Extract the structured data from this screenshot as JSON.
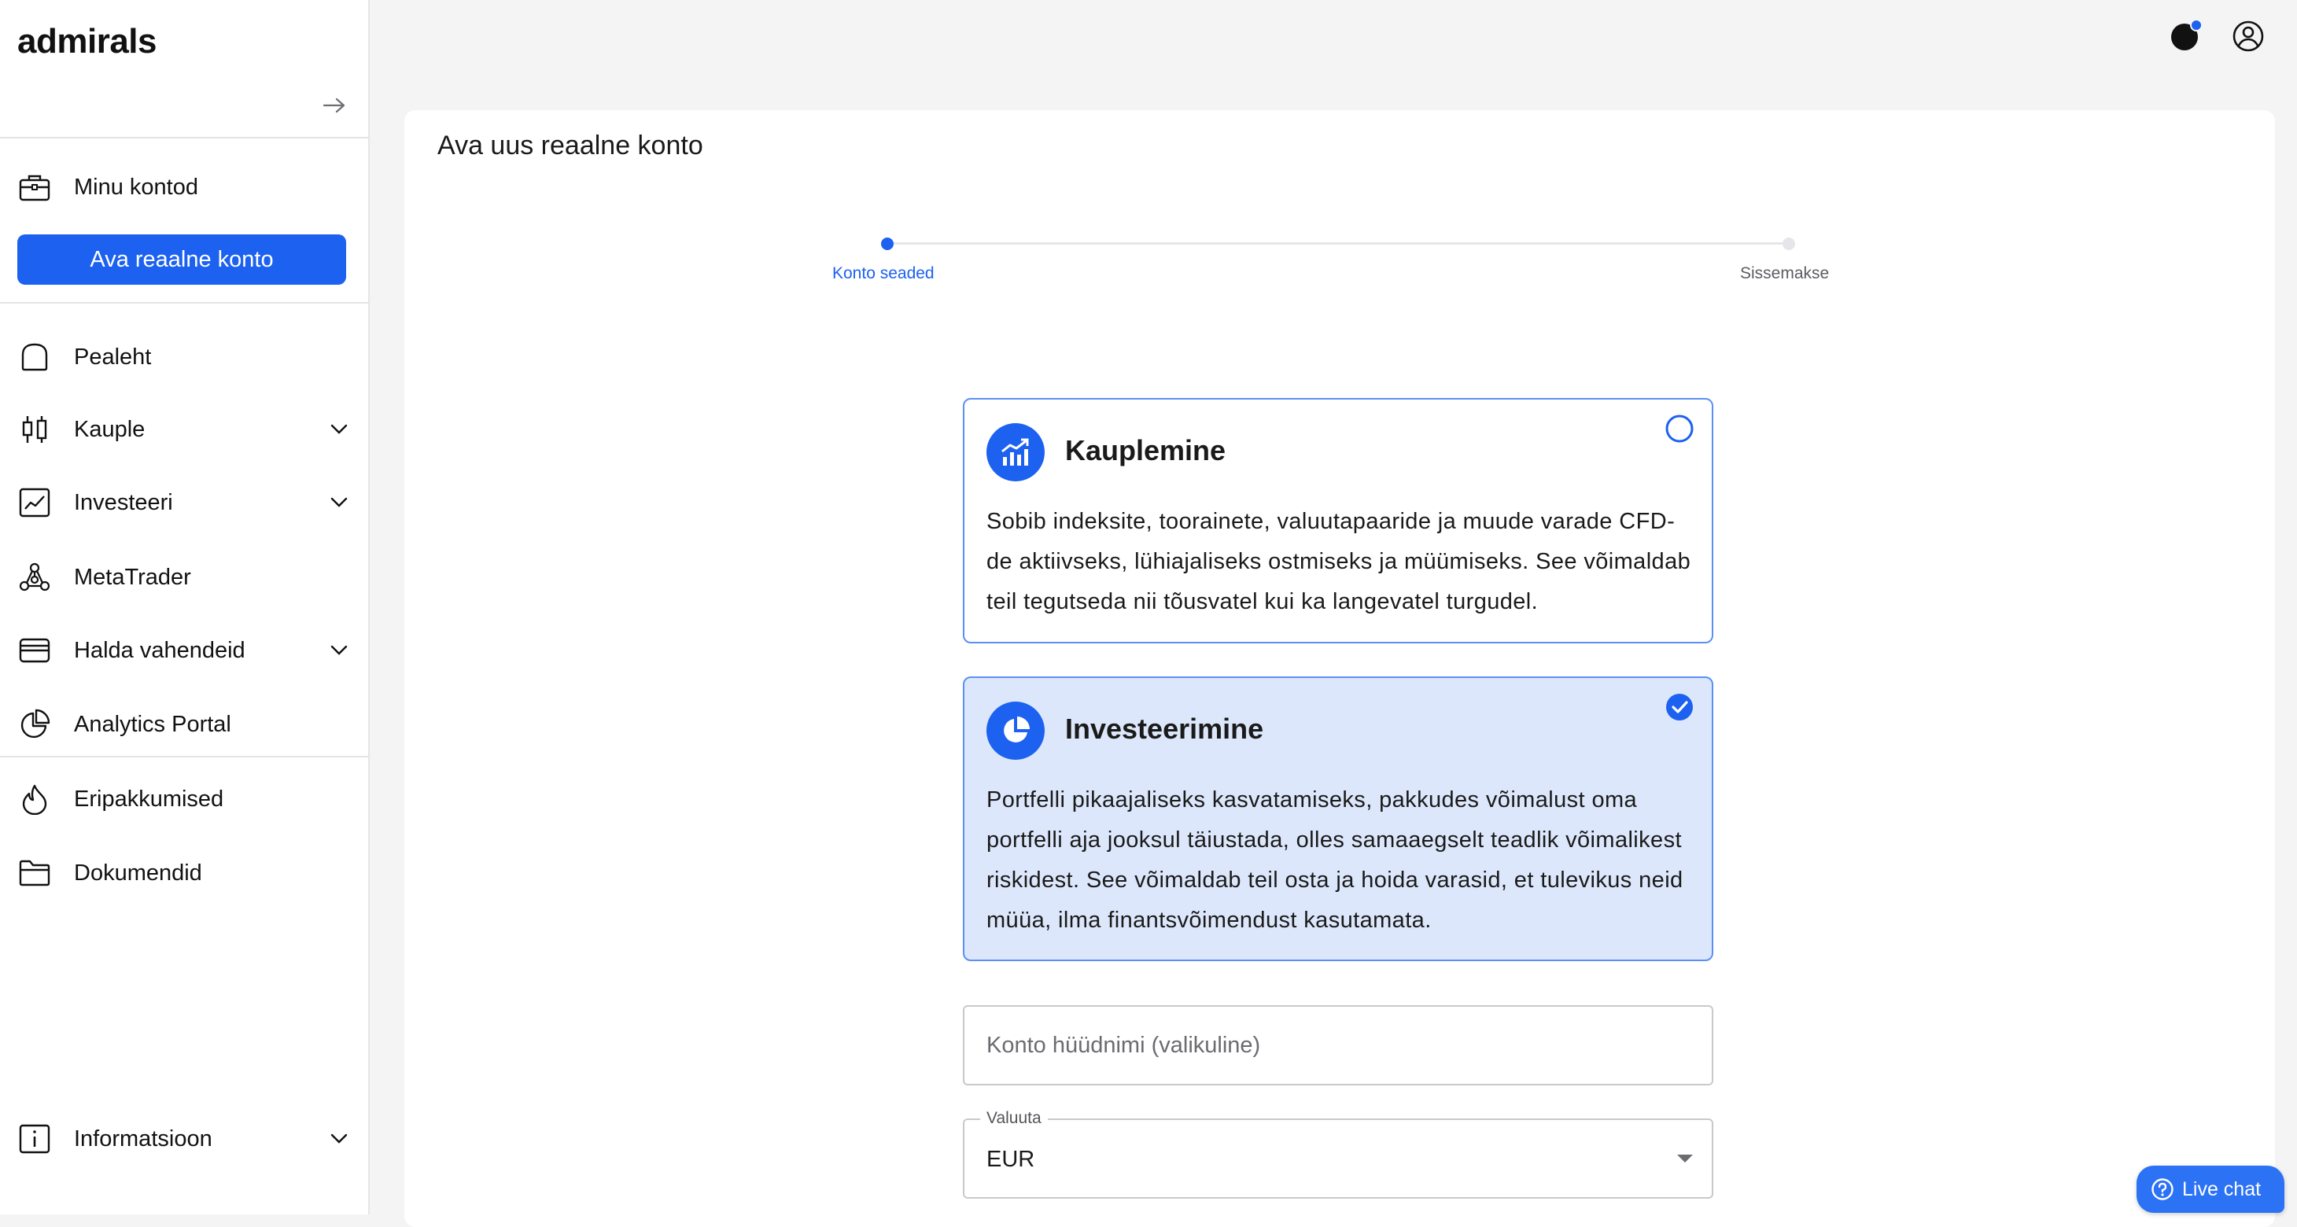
{
  "brand": {
    "logo_text": "admirals",
    "accent": "#1c61f0"
  },
  "sidebar": {
    "primary_button": "Ava reaalne konto",
    "top_item": {
      "label": "Minu kontod",
      "icon": "briefcase-icon"
    },
    "items": [
      {
        "label": "Pealeht",
        "icon": "home-icon",
        "has_chevron": false
      },
      {
        "label": "Kauple",
        "icon": "candlestick-icon",
        "has_chevron": true
      },
      {
        "label": "Investeeri",
        "icon": "chart-line-icon",
        "has_chevron": true
      },
      {
        "label": "MetaTrader",
        "icon": "network-icon",
        "has_chevron": false
      },
      {
        "label": "Halda vahendeid",
        "icon": "wallet-icon",
        "has_chevron": true
      },
      {
        "label": "Analytics Portal",
        "icon": "pie-chart-icon",
        "has_chevron": false
      },
      {
        "label": "Eripakkumised",
        "icon": "flame-icon",
        "has_chevron": false
      },
      {
        "label": "Dokumendid",
        "icon": "folder-icon",
        "has_chevron": false
      }
    ],
    "bottom_item": {
      "label": "Informatsioon",
      "icon": "info-icon",
      "has_chevron": true
    }
  },
  "main": {
    "title": "Ava uus reaalne konto",
    "stepper": {
      "steps": [
        {
          "label": "Konto seaded",
          "active": true
        },
        {
          "label": "Sissemakse",
          "active": false
        }
      ]
    },
    "cards": [
      {
        "title": "Kauplemine",
        "description": "Sobib indeksite, toorainete, valuutapaaride ja muude varade CFD-de aktiivseks, lühiajaliseks ostmiseks ja müümiseks. See võimaldab teil tegutseda nii tõusvatel kui ka langevatel turgudel.",
        "icon": "trending-up-icon",
        "selected": false
      },
      {
        "title": "Investeerimine",
        "description": "Portfelli pikaajaliseks kasvatamiseks, pakkudes võimalust oma portfelli aja jooksul täiustada, olles samaaegselt teadlik võimalikest riskidest. See võimaldab teil osta ja hoida varasid, et tulevikus neid müüa, ilma finantsvõimendust kasutamata.",
        "icon": "pie-chart-icon",
        "selected": true
      }
    ],
    "nickname_input": {
      "placeholder": "Konto hüüdnimi (valikuline)",
      "value": ""
    },
    "currency_select": {
      "label": "Valuuta",
      "value": "EUR"
    }
  },
  "live_chat": {
    "label": "Live chat"
  }
}
